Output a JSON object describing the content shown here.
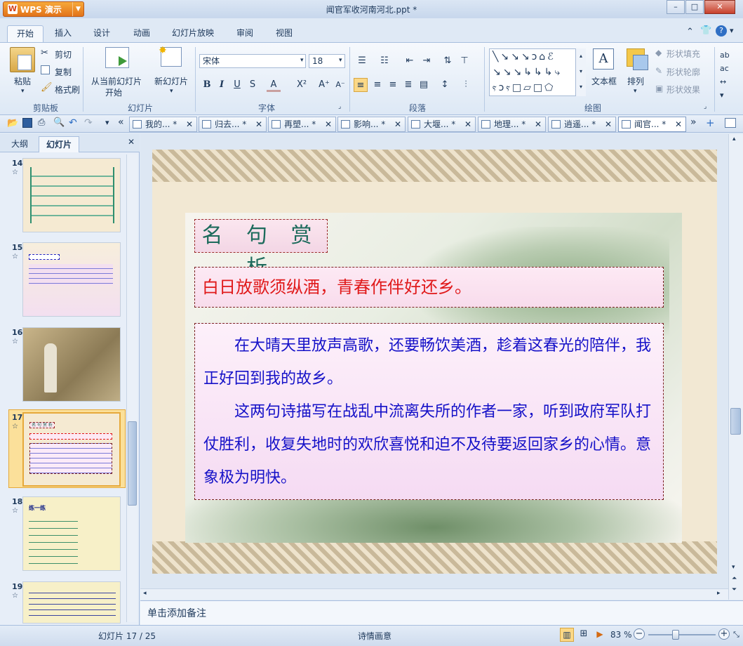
{
  "app": {
    "button": "WPS 演示",
    "title": "闻官军收河南河北.ppt *"
  },
  "ribbon_tabs": [
    "开始",
    "插入",
    "设计",
    "动画",
    "幻灯片放映",
    "审阅",
    "视图"
  ],
  "clipboard": {
    "paste": "粘贴",
    "cut": "剪切",
    "copy": "复制",
    "format": "格式刷",
    "group": "剪贴板"
  },
  "slides_group": {
    "from_current": "从当前幻灯片",
    "start": "开始",
    "new_slide": "新幻灯片",
    "group": "幻灯片"
  },
  "font": {
    "name": "宋体",
    "size": "18",
    "group": "字体"
  },
  "paragraph": {
    "group": "段落"
  },
  "drawing": {
    "textbox": "文本框",
    "arrange": "排列",
    "fill": "形状填充",
    "outline": "形状轮廓",
    "effect": "形状效果",
    "group": "绘图"
  },
  "doc_tabs": [
    "我的... *",
    "归去... *",
    "再塑... *",
    "影响... *",
    "大堰... *",
    "地理... *",
    "逍遥... *",
    "闻官... *"
  ],
  "panel": {
    "tab_outline": "大纲",
    "tab_slides": "幻灯片"
  },
  "thumbnails": [
    {
      "num": "14",
      "title": ""
    },
    {
      "num": "15",
      "title": ""
    },
    {
      "num": "16",
      "title": ""
    },
    {
      "num": "17",
      "title": "名 句 赏 析"
    },
    {
      "num": "18",
      "title": "练一练"
    },
    {
      "num": "19",
      "title": ""
    }
  ],
  "slide": {
    "title": "名 句 赏 析",
    "quote": "白日放歌须纵酒，青春作伴好还乡。",
    "para1": "在大晴天里放声高歌，还要畅饮美酒，趁着这春光的陪伴，我正好回到我的故乡。",
    "para2": "这两句诗描写在战乱中流离失所的作者一家，听到政府军队打仗胜利，收复失地时的欢欣喜悦和迫不及待要返回家乡的心情。意象极为明快。"
  },
  "notes_placeholder": "单击添加备注",
  "status": {
    "slide_pos": "幻灯片 17 / 25",
    "theme": "诗情画意",
    "zoom": "83 %"
  },
  "colors": {
    "accent": "#e2731a",
    "title_green": "#1d6b5c",
    "quote_red": "#e0191a",
    "body_blue": "#1511c8"
  }
}
